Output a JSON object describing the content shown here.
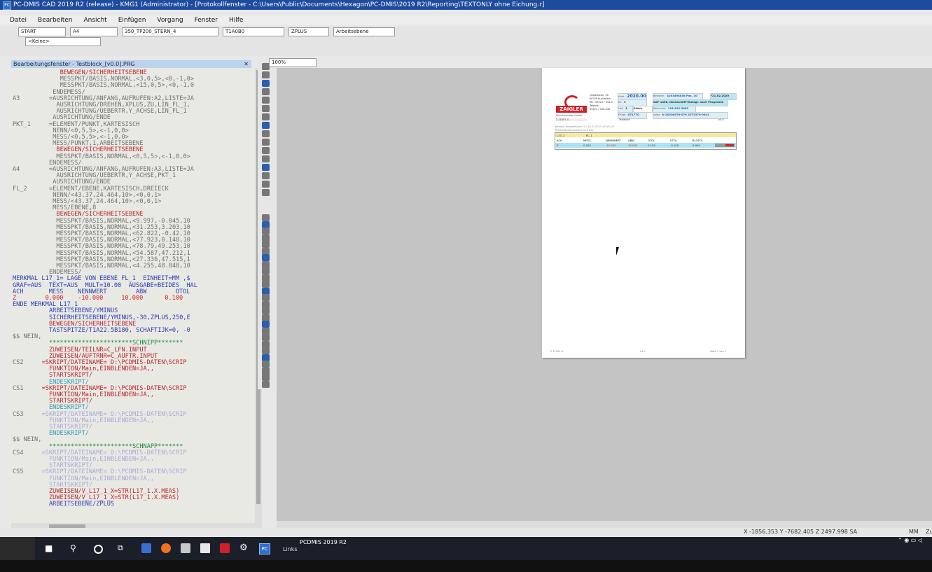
{
  "window": {
    "title": "PC-DMIS CAD 2019 R2 (release) - KMG1 (Administrator) - [Protokollfenster - C:\\Users\\Public\\Documents\\Hexagon\\PC-DMIS\\2019 R2\\Reporting\\TEXTONLY ohne Eichung.r]",
    "app_icon": "PC"
  },
  "menu": [
    "Datei",
    "Bearbeiten",
    "Ansicht",
    "Einfügen",
    "Vorgang",
    "Fenster",
    "Hilfe"
  ],
  "toolbar": {
    "combos": [
      "START",
      "A4",
      "350_TP200_STERN_4",
      "T1A0B0",
      "ZPLUS",
      "Arbeitsebene",
      "<Keine>"
    ],
    "zoom": "100%"
  },
  "editor": {
    "title": "Bearbeitungsfenster - Testblock_[v0.0].PRG",
    "lines": [
      {
        "label": "",
        "text": "BEWEGEN/SICHERHEITSEBENE",
        "indent": 13,
        "color": "#b8282e"
      },
      {
        "label": "",
        "text": "MESSPKT/BASIS,NORMAL,<3,0,5>,<0,-1,0>",
        "indent": 13,
        "color": "#707070"
      },
      {
        "label": "",
        "text": "MESSPKT/BASIS,NORMAL,<15,0,5>,<0,-1,0",
        "indent": 13,
        "color": "#707070"
      },
      {
        "label": "",
        "text": "ENDEMESS/",
        "indent": 11,
        "color": "#707070"
      },
      {
        "label": "A3",
        "text": "=AUSRICHTUNG/ANFANG,AUFRUFEN:A2,LISTE=JA",
        "indent": 10,
        "color": "#707070"
      },
      {
        "label": "",
        "text": "AUSRICHTUNG/DREHEN,XPLUS,ZU,LIN_FL_1,",
        "indent": 12,
        "color": "#707070"
      },
      {
        "label": "",
        "text": "AUSRICHTUNG/UEBERTR,Y_ACHSE,LIN_FL_1",
        "indent": 12,
        "color": "#707070"
      },
      {
        "label": "",
        "text": "AUSRICHTUNG/ENDE",
        "indent": 11,
        "color": "#707070"
      },
      {
        "label": "PKT_1",
        "text": "=ELEMENT/PUNKT,KARTESISCH",
        "indent": 10,
        "color": "#707070"
      },
      {
        "label": "",
        "text": "NENN/<0,5,5>,<-1,0,0>",
        "indent": 11,
        "color": "#707070"
      },
      {
        "label": "",
        "text": "MESS/<0,5,5>,<-1,0,0>",
        "indent": 11,
        "color": "#707070"
      },
      {
        "label": "",
        "text": "MESS/PUNKT,1,ARBEITSEBENE",
        "indent": 11,
        "color": "#707070"
      },
      {
        "label": "",
        "text": "BEWEGEN/SICHERHEITSEBENE",
        "indent": 12,
        "color": "#b8282e"
      },
      {
        "label": "",
        "text": "MESSPKT/BASIS,NORMAL,<0,5,5>,<-1,0,0>",
        "indent": 12,
        "color": "#707070"
      },
      {
        "label": "",
        "text": "ENDEMESS/",
        "indent": 10,
        "color": "#707070"
      },
      {
        "label": "A4",
        "text": "=AUSRICHTUNG/ANFANG,AUFRUFEN:A3,LISTE=JA",
        "indent": 10,
        "color": "#707070"
      },
      {
        "label": "",
        "text": "AUSRICHTUNG/UEBERTR,Y_ACHSE,PKT_1",
        "indent": 12,
        "color": "#707070"
      },
      {
        "label": "",
        "text": "AUSRICHTUNG/ENDE",
        "indent": 11,
        "color": "#707070"
      },
      {
        "label": "FL_2",
        "text": "=ELEMENT/EBENE,KARTESISCH,DREIECK",
        "indent": 10,
        "color": "#707070"
      },
      {
        "label": "",
        "text": "NENN/<43.37,24.464,10>,<0,0,1>",
        "indent": 11,
        "color": "#707070"
      },
      {
        "label": "",
        "text": "MESS/<43.37,24.464,10>,<0,0,1>",
        "indent": 11,
        "color": "#707070"
      },
      {
        "label": "",
        "text": "MESS/EBENE,8",
        "indent": 11,
        "color": "#707070"
      },
      {
        "label": "",
        "text": "BEWEGEN/SICHERHEITSEBENE",
        "indent": 12,
        "color": "#b8282e"
      },
      {
        "label": "",
        "text": "MESSPKT/BASIS,NORMAL,<9.997,-0.045,10",
        "indent": 12,
        "color": "#707070"
      },
      {
        "label": "",
        "text": "MESSPKT/BASIS,NORMAL,<31.253,3.203,10",
        "indent": 12,
        "color": "#707070"
      },
      {
        "label": "",
        "text": "MESSPKT/BASIS,NORMAL,<62.822,-0.42,10",
        "indent": 12,
        "color": "#707070"
      },
      {
        "label": "",
        "text": "MESSPKT/BASIS,NORMAL,<77.923,0.148,10",
        "indent": 12,
        "color": "#707070"
      },
      {
        "label": "",
        "text": "MESSPKT/BASIS,NORMAL,<78.79,49.253,10",
        "indent": 12,
        "color": "#707070"
      },
      {
        "label": "",
        "text": "MESSPKT/BASIS,NORMAL,<54.587,47.212,1",
        "indent": 12,
        "color": "#707070"
      },
      {
        "label": "",
        "text": "MESSPKT/BASIS,NORMAL,<27.336,47.515,1",
        "indent": 12,
        "color": "#707070"
      },
      {
        "label": "",
        "text": "MESSPKT/BASIS,NORMAL,<4.255,48.848,10",
        "indent": 12,
        "color": "#707070"
      },
      {
        "label": "",
        "text": "ENDEMESS/",
        "indent": 10,
        "color": "#707070"
      },
      {
        "label": "MERKMAL L17_1= LAGE VON EBENE FL_1  EINHEIT=MM ,$",
        "text": "",
        "indent": 0,
        "color": "#2a3db4"
      },
      {
        "label": "GRAF=AUS  TEXT=AUS  MULT=10.00  AUSGABE=BEIDES  HAL",
        "text": "",
        "indent": 0,
        "color": "#2a3db4"
      },
      {
        "label": "ACH       MESS    NENNWERT        ABW        OTOL",
        "text": "",
        "indent": 0,
        "color": "#2a3db4"
      },
      {
        "label": "Z        0.000    -10.000     10.000      0.100",
        "text": "",
        "indent": 0,
        "color": "#d02020"
      },
      {
        "label": "ENDE MERKMAL L17_1",
        "text": "",
        "indent": 0,
        "color": "#2a3db4"
      },
      {
        "label": "",
        "text": "ARBEITSEBENE/YMINUS",
        "indent": 10,
        "color": "#2a3db4"
      },
      {
        "label": "",
        "text": "SICHERHEITSEBENE/YMINUS,-30,ZPLUS,250,E",
        "indent": 10,
        "color": "#2a3db4"
      },
      {
        "label": "",
        "text": "BEWEGEN/SICHERHEITSEBENE",
        "indent": 10,
        "color": "#b8282e"
      },
      {
        "label": "",
        "text": "TASTSPITZE/T1A22.5B180, SCHAFTIJK=0, -0",
        "indent": 10,
        "color": "#2a3db4"
      },
      {
        "label": "$$ NEIN,",
        "text": "",
        "indent": 0,
        "color": "#707070"
      },
      {
        "label": "",
        "text": "***********************SCHNIPP*******",
        "indent": 10,
        "color": "#1f8a3a"
      },
      {
        "label": "",
        "text": "ZUWEISEN/TEILNR=C_LFN.INPUT",
        "indent": 10,
        "color": "#b8282e"
      },
      {
        "label": "",
        "text": "ZUWEISEN/AUFTRNR=C_AUFTR.INPUT",
        "indent": 10,
        "color": "#b8282e"
      },
      {
        "label": "CS2",
        "text": "=SKRIPT/DATEINAME= D:\\PCDMIS-DATEN\\SCRIP",
        "indent": 8,
        "color": "#b8282e"
      },
      {
        "label": "",
        "text": "FUNKTION/Main,EINBLENDEN=JA,,",
        "indent": 10,
        "color": "#b8282e"
      },
      {
        "label": "",
        "text": "STARTSKRIPT/",
        "indent": 10,
        "color": "#b8282e"
      },
      {
        "label": "",
        "text": "ENDESKRIPT/",
        "indent": 10,
        "color": "#2a9ab4"
      },
      {
        "label": "CS1",
        "text": "=SKRIPT/DATEINAME= D:\\PCDMIS-DATEN\\SCRIP",
        "indent": 8,
        "color": "#b8282e"
      },
      {
        "label": "",
        "text": "FUNKTION/Main,EINBLENDEN=JA,,",
        "indent": 10,
        "color": "#b8282e"
      },
      {
        "label": "",
        "text": "STARTSKRIPT/",
        "indent": 10,
        "color": "#b8282e"
      },
      {
        "label": "",
        "text": "ENDESKRIPT/",
        "indent": 10,
        "color": "#2a9ab4"
      },
      {
        "label": "CS3",
        "text": "=SKRIPT/DATEINAME= D:\\PCDMIS-DATEN\\SCRIP",
        "indent": 8,
        "color": "#a8a8d8"
      },
      {
        "label": "",
        "text": "FUNKTION/Main,EINBLENDEN=JA,,",
        "indent": 10,
        "color": "#a8a8d8"
      },
      {
        "label": "",
        "text": "STARTSKRIPT/",
        "indent": 10,
        "color": "#a8a8d8"
      },
      {
        "label": "",
        "text": "ENDESKRIPT/",
        "indent": 10,
        "color": "#2a9ab4"
      },
      {
        "label": "$$ NEIN,",
        "text": "",
        "indent": 0,
        "color": "#707070"
      },
      {
        "label": "",
        "text": "***********************SCHNAPP*******",
        "indent": 10,
        "color": "#1f8a3a"
      },
      {
        "label": "CS4",
        "text": "=SKRIPT/DATEINAME= D:\\PCDMIS-DATEN\\SCRIP",
        "indent": 8,
        "color": "#a8a8d8"
      },
      {
        "label": "",
        "text": "FUNKTION/Main,EINBLENDEN=JA,,",
        "indent": 10,
        "color": "#a8a8d8"
      },
      {
        "label": "",
        "text": "STARTSKRIPT/",
        "indent": 10,
        "color": "#a8a8d8"
      },
      {
        "label": "CS5",
        "text": "=SKRIPT/DATEINAME= D:\\PCDMIS-DATEN\\SCRIP",
        "indent": 8,
        "color": "#a8a8d8"
      },
      {
        "label": "",
        "text": "FUNKTION/Main,EINBLENDEN=JA,,",
        "indent": 10,
        "color": "#a8a8d8"
      },
      {
        "label": "",
        "text": "STARTSKRIPT/",
        "indent": 10,
        "color": "#a8a8d8"
      },
      {
        "label": "",
        "text": "ZUWEISEN/V_L17_1_X=STR(L17_1.X.MEAS)",
        "indent": 10,
        "color": "#b8282e"
      },
      {
        "label": "",
        "text": "ZUWEISEN/V_L17_1_X=STR(L17_1.X.MEAS)",
        "indent": 10,
        "color": "#b8282e"
      },
      {
        "label": "",
        "text": "ARBEITSEBENE/ZPLUS",
        "indent": 10,
        "color": "#2a3db4"
      }
    ]
  },
  "report": {
    "company": "ZAIGLER",
    "company_sub": "Maschinenbau GmbH",
    "address": [
      "Gewerbestr. 18",
      "90329 Kuchtbach",
      "Tel.: 09221 / 944-0",
      "Telefax:",
      "09221 / 944-444"
    ],
    "fields": [
      {
        "label": "Auftr.",
        "value": "2020.0089"
      },
      {
        "label": "Bestellnr.",
        "value": "4203498836 Pos. 10"
      },
      {
        "label": "",
        "value": "*21.02.2020"
      },
      {
        "label": "Nr.",
        "value": "0"
      },
      {
        "label": "",
        "value": "SAP 1466, Nachschliff+Katagr. nach Programm"
      },
      {
        "label": "Lief.",
        "value": "1"
      },
      {
        "label": "",
        "value": "Stück"
      },
      {
        "label": "Zeichn.Nr.",
        "value": "115.612.3062"
      },
      {
        "label": "Prüfer",
        "value": "GT1770"
      },
      {
        "label": "Index",
        "value": "N 20200070-070 20T2370-0041"
      }
    ],
    "ref_code": "2.11507.4",
    "block": "Testblock",
    "block_version": "v0.0",
    "temperature_line": "Aktuelle Temperaturen: X=20 Y=20 Z=20 W=20",
    "limits_line": "Temperaturgrenzwerte (um RS)",
    "feature": "L17_1",
    "feature_ref": "FL_1",
    "columns": [
      "ACH",
      "MESS",
      "NENNWERT",
      "ABW",
      "OTOL",
      "UTOL",
      "BLOTOL"
    ],
    "row": [
      "Z",
      "0.000",
      "-10.000",
      "10.000",
      "0.100",
      "-0.100",
      "9.900"
    ],
    "footer_left": "2.11507.4",
    "footer_mid": "v1.0",
    "footer_right": "Seite 1 von 1"
  },
  "status": {
    "coords": "X -1856.353 Y -7682.405 Z 2497.998 SA",
    "units": "MM",
    "extra": "Zu"
  },
  "taskbar": {
    "task_title": "PCDMIS 2019 R2",
    "task_sub": "Links"
  }
}
